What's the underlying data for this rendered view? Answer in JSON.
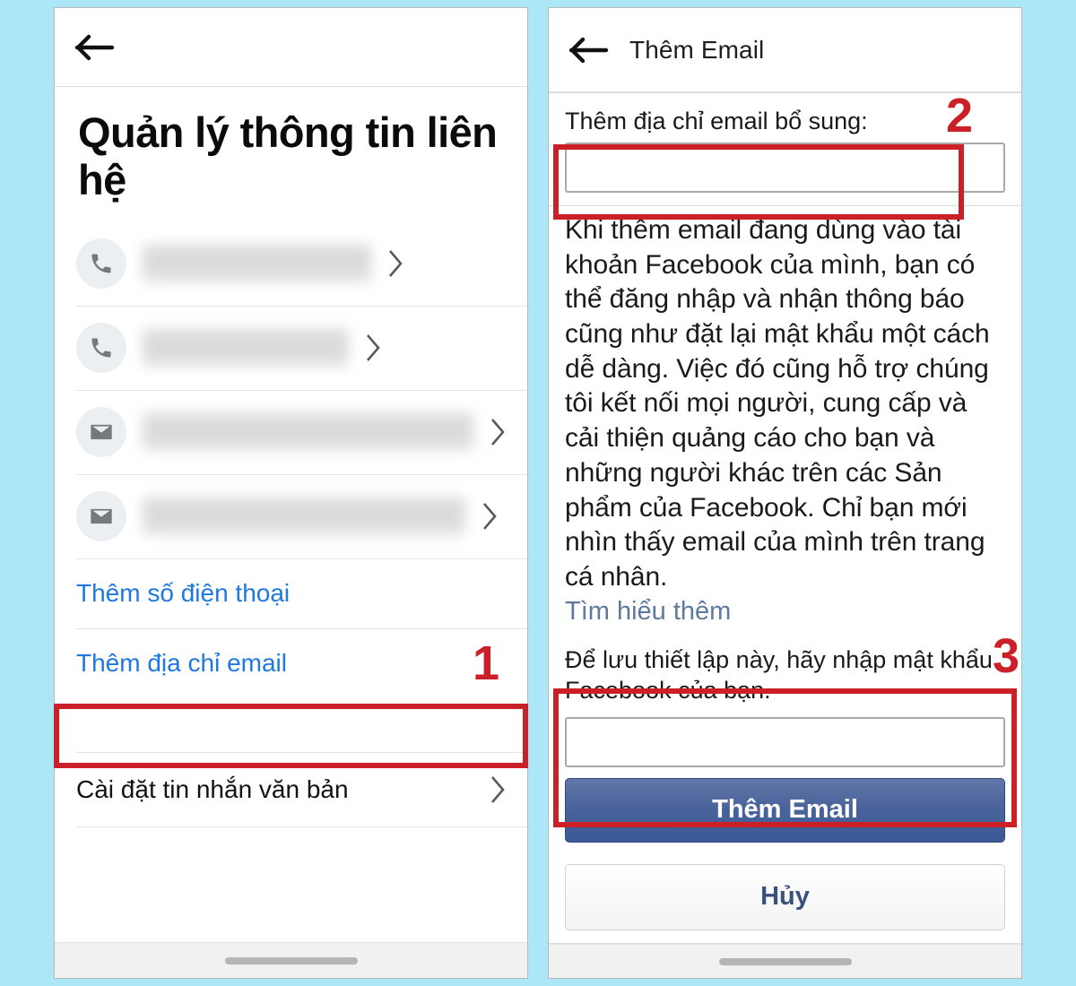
{
  "background_color": "#ace7f7",
  "annotation_color": "#cb2027",
  "left_screen": {
    "back_icon": "back-arrow-icon",
    "page_title": "Quản lý thông tin liên hệ",
    "contacts": [
      {
        "icon": "phone-icon",
        "value_redacted": true
      },
      {
        "icon": "phone-icon",
        "value_redacted": true
      },
      {
        "icon": "envelope-icon",
        "value_redacted": true
      },
      {
        "icon": "envelope-icon",
        "value_redacted": true
      }
    ],
    "add_phone_label": "Thêm số điện thoại",
    "add_email_label": "Thêm địa chỉ email",
    "sms_settings_label": "Cài đặt tin nhắn văn bản",
    "link_color": "#1f78e0"
  },
  "right_screen": {
    "back_icon": "back-arrow-icon",
    "nav_title": "Thêm Email",
    "email_field_label": "Thêm địa chỉ email bổ sung:",
    "email_field_value": "",
    "email_field_placeholder": "",
    "description": "Khi thêm email đang dùng vào tài khoản Facebook của mình, bạn có thể đăng nhập và nhận thông báo cũng như đặt lại mật khẩu một cách dễ dàng. Việc đó cũng hỗ trợ chúng tôi kết nối mọi người, cung cấp và cải thiện quảng cáo cho bạn và những người khác trên các Sản phẩm của Facebook. Chỉ bạn mới nhìn thấy email của mình trên trang cá nhân.",
    "learn_more_label": "Tìm hiểu thêm",
    "password_note": "Để lưu thiết lập này, hãy nhập mật khẩu Facebook của bạn.",
    "password_field_value": "",
    "password_field_placeholder": "",
    "submit_label": "Thêm Email",
    "cancel_label": "Hủy",
    "submit_color": "#3b5998",
    "learn_more_color": "#5d7a9e"
  },
  "annotations": [
    {
      "number": "1",
      "target": "add-email-link"
    },
    {
      "number": "2",
      "target": "email-input"
    },
    {
      "number": "3",
      "target": "password-and-submit"
    }
  ]
}
